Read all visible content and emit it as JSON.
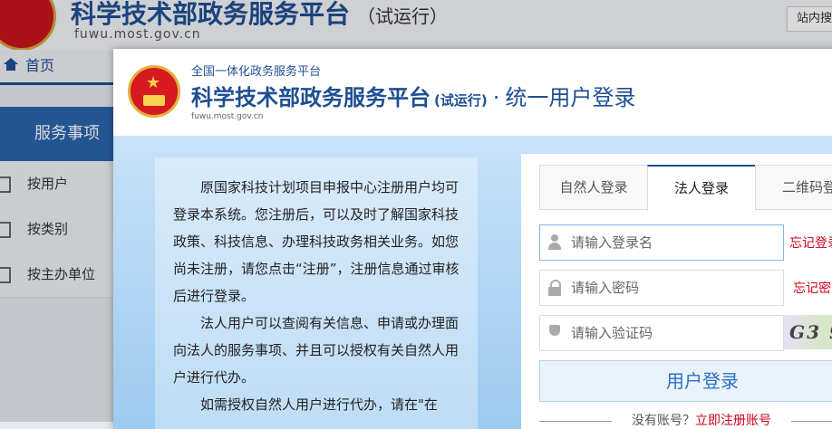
{
  "background": {
    "site_title": "科学技术部政务服务平台",
    "site_trial": "（试运行）",
    "site_url": "fuwu.most.gov.cn",
    "search_label": "站内搜",
    "nav_home": "首页",
    "side_header": "服务事项",
    "side_items": [
      "按用户",
      "按类别",
      "按主办单位"
    ]
  },
  "dialog": {
    "subtitle": "全国一体化政务服务平台",
    "title": "科学技术部政务服务平台",
    "trial": "(试运行)",
    "separator": "·",
    "unified": "统一用户登录",
    "url": "fuwu.most.gov.cn",
    "info_paragraphs": [
      "原国家科技计划项目申报中心注册用户均可登录本系统。您注册后，可以及时了解国家科技政策、科技信息、办理科技政务相关业务。如您尚未注册，请您点击“注册”，注册信息通过审核后进行登录。",
      "法人用户可以查阅有关信息、申请或办理面向法人的服务事项、并且可以授权有关自然人用户进行代办。",
      "如需授权自然人用户进行代办，请在\"在"
    ],
    "tabs": [
      "自然人登录",
      "法人登录",
      "二维码登"
    ],
    "active_tab": 1,
    "username_placeholder": "请输入登录名",
    "password_placeholder": "请输入密码",
    "captcha_placeholder": "请输入验证码",
    "forgot_username": "忘记登录",
    "forgot_password": "忘记密",
    "captcha_text": "G3 9",
    "login_button": "用户登录",
    "no_account": "没有账号？",
    "register_link": "立即注册账号"
  }
}
